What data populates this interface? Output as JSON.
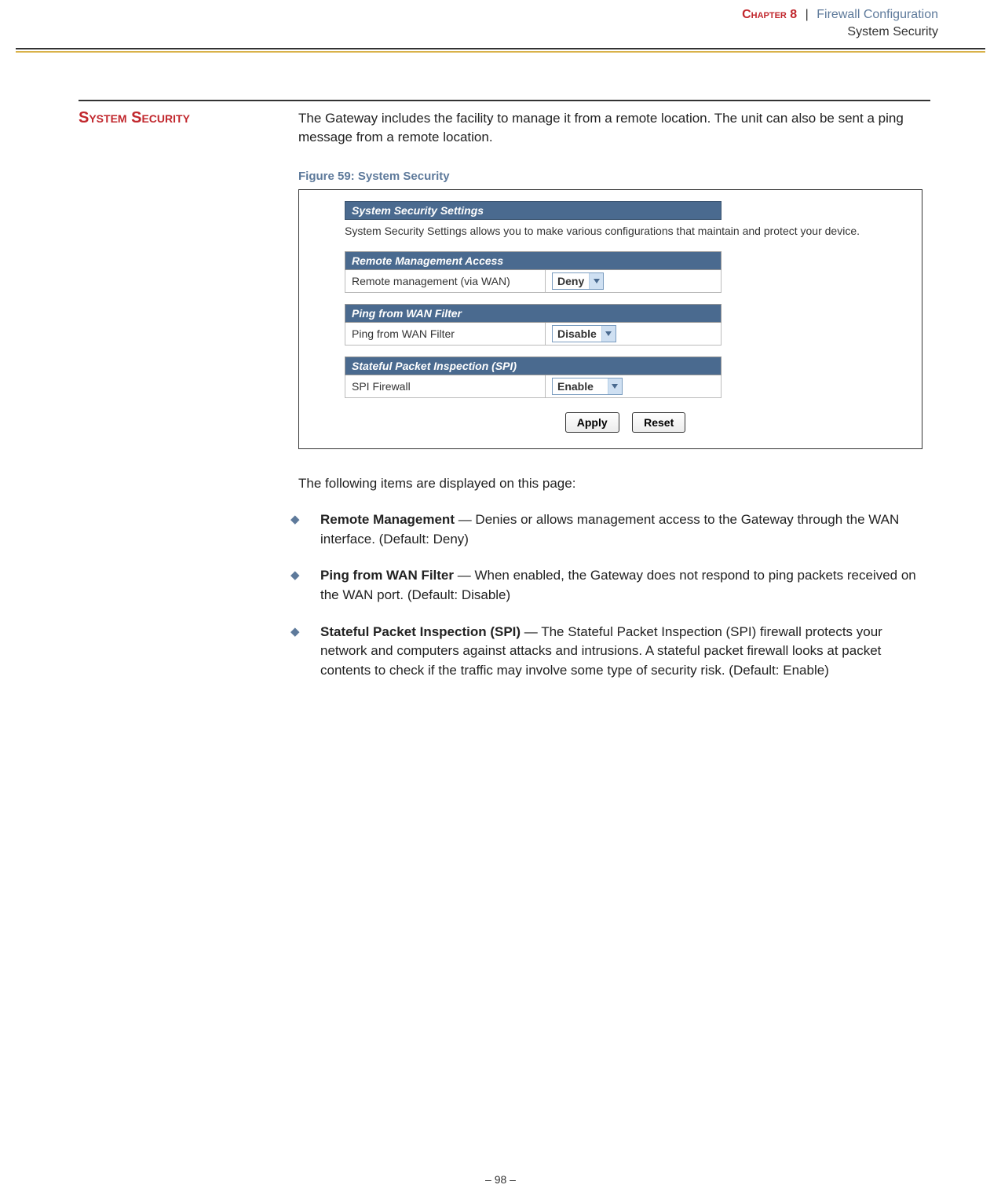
{
  "header": {
    "chapter_label": "Chapter 8",
    "separator": "|",
    "chapter_title": "Firewall Configuration",
    "section_subtitle": "System Security"
  },
  "section": {
    "heading": "System Security",
    "intro": "The Gateway includes the facility to manage it from a remote location. The unit can also be sent a ping message from a remote location.",
    "figure_caption": "Figure 59:  System Security"
  },
  "screenshot": {
    "panel1_header": "System Security Settings",
    "panel1_desc": "System Security Settings allows you to make various configurations that maintain and protect your device.",
    "panel2_header": "Remote Management Access",
    "panel2_label": "Remote management (via WAN)",
    "panel2_value": "Deny",
    "panel3_header": "Ping from WAN Filter",
    "panel3_label": "Ping from WAN Filter",
    "panel3_value": "Disable",
    "panel4_header": "Stateful Packet Inspection (SPI)",
    "panel4_label": "SPI Firewall",
    "panel4_value": "Enable",
    "apply_btn": "Apply",
    "reset_btn": "Reset"
  },
  "following": {
    "intro": "The following items are displayed on this page:",
    "items": [
      {
        "label": "Remote Management",
        "desc": " — Denies or allows management access to the Gateway through the WAN interface. (Default: Deny)"
      },
      {
        "label": "Ping from WAN Filter",
        "desc": " — When enabled, the Gateway does not respond to ping packets received on the WAN port. (Default: Disable)"
      },
      {
        "label": "Stateful Packet Inspection (SPI)",
        "desc": " — The Stateful Packet Inspection (SPI) firewall protects your network and computers against attacks and intrusions. A stateful packet firewall looks at packet contents to check if the traffic may involve some type of security risk. (Default: Enable)"
      }
    ]
  },
  "footer": {
    "page": "–  98  –"
  }
}
